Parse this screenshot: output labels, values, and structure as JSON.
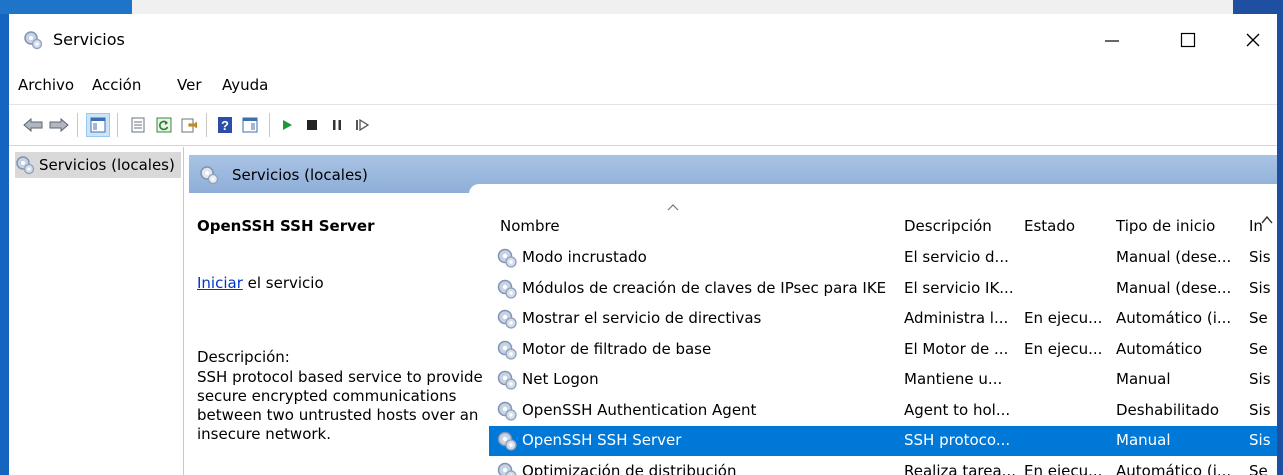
{
  "window": {
    "title": "Servicios"
  },
  "menu": [
    "Archivo",
    "Acción",
    "Ver",
    "Ayuda"
  ],
  "tree": {
    "root_label": "Servicios (locales)"
  },
  "main": {
    "header_title": "Servicios (locales)"
  },
  "details": {
    "service_name": "OpenSSH SSH Server",
    "start_link": "Iniciar",
    "start_suffix": " el servicio",
    "description_label": "Descripción:",
    "description_text": "SSH protocol based service to provide secure encrypted communications between two untrusted hosts over an insecure network."
  },
  "columns": [
    "Nombre",
    "Descripción",
    "Estado",
    "Tipo de inicio",
    "In"
  ],
  "rows": [
    {
      "name": "Modo incrustado",
      "description": "El servicio d...",
      "status": "",
      "startup": "Manual (dese...",
      "logon": "Sis"
    },
    {
      "name": "Módulos de creación de claves de IPsec para IKE ...",
      "description": "El servicio IK...",
      "status": "",
      "startup": "Manual (dese...",
      "logon": "Sis"
    },
    {
      "name": "Mostrar el servicio de directivas",
      "description": "Administra l...",
      "status": "En ejecu...",
      "startup": "Automático (i...",
      "logon": "Se"
    },
    {
      "name": "Motor de filtrado de base",
      "description": "El Motor de ...",
      "status": "En ejecu...",
      "startup": "Automático",
      "logon": "Se"
    },
    {
      "name": "Net Logon",
      "description": "Mantiene u...",
      "status": "",
      "startup": "Manual",
      "logon": "Sis"
    },
    {
      "name": "OpenSSH Authentication Agent",
      "description": "Agent to hol...",
      "status": "",
      "startup": "Deshabilitado",
      "logon": "Sis"
    },
    {
      "name": "OpenSSH SSH Server",
      "description": "SSH protoco...",
      "status": "",
      "startup": "Manual",
      "logon": "Sis",
      "selected": true
    },
    {
      "name": "Optimización de distribución",
      "description": "Realiza tarea...",
      "status": "En ejecu...",
      "startup": "Automático (i...",
      "logon": "Se"
    }
  ],
  "colors": {
    "accent": "#0078d7",
    "header_blue": "#9bb8df",
    "link": "#0033cc"
  }
}
